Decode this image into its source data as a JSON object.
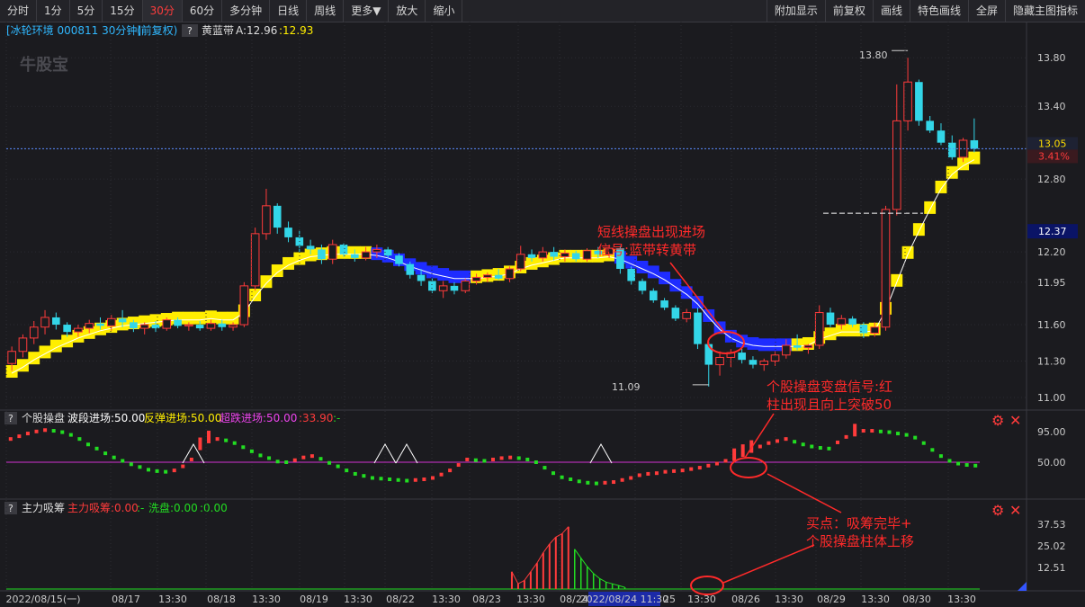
{
  "toolbar": {
    "left": [
      "分时",
      "1分",
      "5分",
      "15分",
      "30分",
      "60分",
      "多分钟",
      "日线",
      "周线",
      "更多▼",
      "放大",
      "缩小"
    ],
    "active": "30分",
    "right": [
      "附加显示",
      "前复权",
      "画线",
      "特色画线",
      "全屏",
      "隐藏主图指标"
    ]
  },
  "header": {
    "stock": "[冰轮环境 000811 30分钟]",
    "fq": "(前复权)",
    "q": "?",
    "indicator": "黄蓝带",
    "a_label": "A:12.96",
    "b_label": ":12.93",
    "watermark": "牛股宝"
  },
  "panel2": {
    "q": "?",
    "name": "个股操盘",
    "l1": "波段进场:50.00",
    "l2": "反弹进场:50.00",
    "l3": "超跌进场:50.00",
    "l4": ":33.90",
    "l5": ":-"
  },
  "panel3": {
    "q": "?",
    "name": "主力吸筹",
    "l1": "主力吸筹:0.00",
    "l2": ":-",
    "l3": "洗盘:0.00",
    "l4": ":0.00"
  },
  "annotations": {
    "a1": [
      "短线操盘出现进场",
      "信号:蓝带转黄带"
    ],
    "a2": [
      "个股操盘变盘信号:红",
      "柱出现且向上突破50"
    ],
    "a3": [
      "买点：吸筹完毕+",
      "个股操盘柱体上移"
    ],
    "high_label": "13.80",
    "low_label": "11.09"
  },
  "colors": {
    "up": "#ff3b3b",
    "down": "#33d6e8",
    "yellow": "#ffee00",
    "blue": "#1e2cff",
    "annot": "#ff2a2a",
    "green": "#22dd22",
    "magenta": "#d030d0"
  },
  "chart_data": [
    {
      "type": "candlestick",
      "title": "冰轮环境 000811 30分钟",
      "ylim": [
        11.0,
        13.95
      ],
      "y_ticks": [
        "13.80",
        "13.40",
        "12.80",
        "12.20",
        "11.95",
        "11.60",
        "11.30",
        "11.00"
      ],
      "current_price": "13.05",
      "change_pct": "3.41%",
      "cursor_price": "12.37",
      "x_labels": [
        "2022/08/15(一)",
        "08/17",
        "13:30",
        "08/18",
        "13:30",
        "08/19",
        "13:30",
        "08/22",
        "13:30",
        "08/23",
        "13:30",
        "08/24",
        "2022/08/24 11:30",
        "25",
        "13:30",
        "08/26",
        "13:30",
        "08/29",
        "13:30",
        "08/30",
        "13:30"
      ],
      "ohlc": [
        [
          11.28,
          11.42,
          11.22,
          11.38
        ],
        [
          11.38,
          11.52,
          11.33,
          11.49
        ],
        [
          11.49,
          11.63,
          11.44,
          11.58
        ],
        [
          11.58,
          11.72,
          11.52,
          11.66
        ],
        [
          11.66,
          11.7,
          11.56,
          11.6
        ],
        [
          11.6,
          11.62,
          11.5,
          11.54
        ],
        [
          11.54,
          11.6,
          11.5,
          11.57
        ],
        [
          11.57,
          11.64,
          11.53,
          11.61
        ],
        [
          11.61,
          11.66,
          11.56,
          11.59
        ],
        [
          11.59,
          11.68,
          11.55,
          11.65
        ],
        [
          11.65,
          11.72,
          11.58,
          11.62
        ],
        [
          11.62,
          11.64,
          11.54,
          11.57
        ],
        [
          11.57,
          11.62,
          11.52,
          11.6
        ],
        [
          11.6,
          11.63,
          11.54,
          11.57
        ],
        [
          11.57,
          11.66,
          11.55,
          11.64
        ],
        [
          11.64,
          11.66,
          11.57,
          11.59
        ],
        [
          11.59,
          11.62,
          11.55,
          11.6
        ],
        [
          11.6,
          11.63,
          11.55,
          11.57
        ],
        [
          11.57,
          11.64,
          11.55,
          11.61
        ],
        [
          11.61,
          11.64,
          11.55,
          11.58
        ],
        [
          11.58,
          11.62,
          11.55,
          11.6
        ],
        [
          11.6,
          11.95,
          11.58,
          11.92
        ],
        [
          11.92,
          12.4,
          11.88,
          12.35
        ],
        [
          12.35,
          12.72,
          12.3,
          12.58
        ],
        [
          12.58,
          12.6,
          12.35,
          12.4
        ],
        [
          12.4,
          12.45,
          12.28,
          12.32
        ],
        [
          12.32,
          12.38,
          12.2,
          12.25
        ],
        [
          12.25,
          12.3,
          12.18,
          12.22
        ],
        [
          12.22,
          12.26,
          12.1,
          12.14
        ],
        [
          12.14,
          12.3,
          12.1,
          12.26
        ],
        [
          12.26,
          12.27,
          12.16,
          12.18
        ],
        [
          12.18,
          12.22,
          12.12,
          12.15
        ],
        [
          12.15,
          12.24,
          12.13,
          12.2
        ],
        [
          12.2,
          12.26,
          12.15,
          12.22
        ],
        [
          12.22,
          12.24,
          12.15,
          12.17
        ],
        [
          12.17,
          12.19,
          12.08,
          12.1
        ],
        [
          12.1,
          12.12,
          11.98,
          12.01
        ],
        [
          12.01,
          12.06,
          11.92,
          11.96
        ],
        [
          11.96,
          11.98,
          11.86,
          11.88
        ],
        [
          11.88,
          11.96,
          11.82,
          11.92
        ],
        [
          11.92,
          11.95,
          11.85,
          11.88
        ],
        [
          11.88,
          11.98,
          11.86,
          11.96
        ],
        [
          11.96,
          12.02,
          11.93,
          11.99
        ],
        [
          11.99,
          12.03,
          11.95,
          12.01
        ],
        [
          12.01,
          12.06,
          11.97,
          11.98
        ],
        [
          11.98,
          12.08,
          11.95,
          12.06
        ],
        [
          12.06,
          12.25,
          12.04,
          12.18
        ],
        [
          12.18,
          12.22,
          12.12,
          12.15
        ],
        [
          12.15,
          12.24,
          12.12,
          12.2
        ],
        [
          12.2,
          12.24,
          12.13,
          12.16
        ],
        [
          12.16,
          12.22,
          12.12,
          12.19
        ],
        [
          12.19,
          12.21,
          12.12,
          12.14
        ],
        [
          12.14,
          12.23,
          12.12,
          12.21
        ],
        [
          12.21,
          12.24,
          12.15,
          12.18
        ],
        [
          12.18,
          12.26,
          12.15,
          12.23
        ],
        [
          12.23,
          12.25,
          12.02,
          12.06
        ],
        [
          12.06,
          12.08,
          11.93,
          11.96
        ],
        [
          11.96,
          11.98,
          11.85,
          11.88
        ],
        [
          11.88,
          11.9,
          11.78,
          11.8
        ],
        [
          11.8,
          11.82,
          11.72,
          11.74
        ],
        [
          11.74,
          11.76,
          11.63,
          11.65
        ],
        [
          11.65,
          11.73,
          11.62,
          11.7
        ],
        [
          11.7,
          11.74,
          11.4,
          11.44
        ],
        [
          11.44,
          11.46,
          11.09,
          11.27
        ],
        [
          11.27,
          11.38,
          11.18,
          11.33
        ],
        [
          11.33,
          11.4,
          11.25,
          11.37
        ],
        [
          11.37,
          11.4,
          11.28,
          11.31
        ],
        [
          11.31,
          11.34,
          11.24,
          11.27
        ],
        [
          11.27,
          11.32,
          11.22,
          11.3
        ],
        [
          11.3,
          11.38,
          11.26,
          11.35
        ],
        [
          11.35,
          11.48,
          11.32,
          11.43
        ],
        [
          11.43,
          11.52,
          11.39,
          11.41
        ],
        [
          11.41,
          11.44,
          11.36,
          11.43
        ],
        [
          11.43,
          11.76,
          11.4,
          11.7
        ],
        [
          11.7,
          11.74,
          11.58,
          11.6
        ],
        [
          11.6,
          11.68,
          11.56,
          11.65
        ],
        [
          11.65,
          11.67,
          11.58,
          11.6
        ],
        [
          11.6,
          11.62,
          11.49,
          11.53
        ],
        [
          11.53,
          11.62,
          11.5,
          11.58
        ],
        [
          11.58,
          12.58,
          11.55,
          12.55
        ],
        [
          12.55,
          13.58,
          12.5,
          13.28
        ],
        [
          13.28,
          13.8,
          13.2,
          13.6
        ],
        [
          13.6,
          13.62,
          13.24,
          13.28
        ],
        [
          13.28,
          13.32,
          13.18,
          13.2
        ],
        [
          13.2,
          13.26,
          13.08,
          13.1
        ],
        [
          13.1,
          13.16,
          12.96,
          12.98
        ],
        [
          12.98,
          13.14,
          12.94,
          13.12
        ],
        [
          13.12,
          13.3,
          13.02,
          13.05
        ]
      ],
      "ribbon_color": [
        "y",
        "y",
        "y",
        "y",
        "y",
        "y",
        "y",
        "y",
        "y",
        "y",
        "y",
        "y",
        "y",
        "y",
        "y",
        "y",
        "y",
        "y",
        "y",
        "y",
        "y",
        "y",
        "y",
        "y",
        "y",
        "y",
        "y",
        "y",
        "y",
        "y",
        "y",
        "y",
        "y",
        "b",
        "b",
        "b",
        "b",
        "b",
        "b",
        "b",
        "b",
        "b",
        "y",
        "y",
        "y",
        "y",
        "y",
        "y",
        "y",
        "y",
        "y",
        "y",
        "y",
        "y",
        "y",
        "b",
        "b",
        "b",
        "b",
        "b",
        "b",
        "b",
        "b",
        "b",
        "b",
        "b",
        "b",
        "b",
        "b",
        "b",
        "b",
        "y",
        "y",
        "y",
        "y",
        "y",
        "y",
        "y",
        "y",
        "y",
        "y",
        "y",
        "y",
        "y",
        "y",
        "y",
        "y",
        "y"
      ],
      "ribbon_value": [
        11.2,
        11.25,
        11.31,
        11.36,
        11.41,
        11.45,
        11.49,
        11.52,
        11.55,
        11.57,
        11.59,
        11.6,
        11.61,
        11.62,
        11.63,
        11.64,
        11.64,
        11.64,
        11.65,
        11.64,
        11.64,
        11.7,
        11.83,
        11.94,
        12.03,
        12.09,
        12.13,
        12.16,
        12.17,
        12.18,
        12.18,
        12.18,
        12.18,
        12.17,
        12.15,
        12.12,
        12.08,
        12.05,
        12.02,
        12.0,
        11.98,
        11.98,
        11.98,
        11.99,
        12.0,
        12.02,
        12.06,
        12.09,
        12.11,
        12.13,
        12.15,
        12.15,
        12.15,
        12.15,
        12.16,
        12.14,
        12.1,
        12.06,
        12.02,
        11.97,
        11.91,
        11.85,
        11.77,
        11.66,
        11.56,
        11.49,
        11.45,
        11.43,
        11.42,
        11.42,
        11.42,
        11.42,
        11.43,
        11.48,
        11.51,
        11.54,
        11.54,
        11.54,
        11.55,
        11.72,
        11.95,
        12.18,
        12.37,
        12.55,
        12.72,
        12.84,
        12.91,
        12.96
      ]
    },
    {
      "type": "bar",
      "title": "个股操盘",
      "ylim": [
        0,
        100
      ],
      "y_ticks": [
        "95.00",
        "50.00"
      ],
      "reference_line": 50,
      "values": [
        84,
        88,
        92,
        95,
        97,
        96,
        94,
        90,
        84,
        76,
        70,
        63,
        57,
        52,
        47,
        43,
        39,
        37,
        36,
        38,
        44,
        54,
        73,
        83,
        84,
        82,
        78,
        72,
        66,
        60,
        56,
        51,
        50,
        53,
        57,
        59,
        55,
        49,
        44,
        38,
        33,
        30,
        27,
        26,
        25,
        24,
        23,
        24,
        25,
        27,
        32,
        38,
        46,
        54,
        53,
        52,
        54,
        56,
        57,
        56,
        54,
        50,
        42,
        34,
        28,
        25,
        22,
        20,
        19,
        20,
        21,
        24,
        27,
        31,
        33,
        34,
        36,
        37,
        38,
        40,
        42,
        45,
        48,
        52,
        57,
        63,
        69,
        73,
        78,
        81,
        84,
        80,
        76,
        73,
        71,
        70,
        79,
        87,
        93,
        96,
        96,
        95,
        94,
        92,
        90,
        86,
        78,
        68,
        59,
        52,
        48,
        46,
        45
      ]
    },
    {
      "type": "bar",
      "title": "主力吸筹",
      "ylim": [
        0,
        40
      ],
      "y_ticks": [
        "37.53",
        "25.02",
        "12.51"
      ],
      "red_values": [
        0,
        0,
        0,
        0,
        0,
        0,
        0,
        0,
        0,
        0,
        0,
        0,
        0,
        0,
        0,
        0,
        0,
        0,
        0,
        0,
        0,
        0,
        0,
        0,
        0,
        0,
        0,
        0,
        0,
        0,
        0,
        0,
        0,
        0,
        0,
        0,
        0,
        0,
        0,
        0,
        0,
        0,
        0,
        0,
        0,
        0,
        0,
        0,
        0,
        0,
        0,
        0,
        0,
        0,
        0,
        0,
        0,
        0,
        0,
        0,
        0,
        0,
        0,
        0,
        0,
        0,
        0,
        0,
        0,
        0,
        0,
        0,
        0,
        0,
        0,
        0,
        0,
        0,
        0,
        0,
        10,
        3,
        5,
        10,
        15,
        21,
        26,
        30,
        32,
        36,
        0,
        0,
        0,
        0,
        0,
        0,
        0,
        0,
        0,
        0,
        0,
        0,
        0,
        0,
        0,
        0,
        0,
        0,
        0,
        0,
        0,
        0,
        0,
        0,
        0,
        0,
        0,
        0,
        0,
        0,
        0,
        0,
        0,
        0,
        0,
        0,
        0,
        0,
        0,
        0,
        0,
        0,
        0,
        0,
        0,
        0,
        0,
        0,
        0,
        0,
        0,
        0,
        0,
        0,
        0,
        0,
        0,
        0,
        0,
        0,
        0,
        0,
        0,
        0,
        0
      ],
      "green_values": [
        0,
        0,
        0,
        0,
        0,
        0,
        0,
        0,
        0,
        0,
        0,
        0,
        0,
        0,
        0,
        0,
        0,
        0,
        0,
        0,
        0,
        0,
        0,
        0,
        0,
        0,
        0,
        0,
        0,
        0,
        0,
        0,
        0,
        0,
        0,
        0,
        0,
        0,
        0,
        0,
        0,
        0,
        0,
        0,
        0,
        0,
        0,
        0,
        0,
        0,
        0,
        0,
        0,
        0,
        0,
        0,
        0,
        0,
        0,
        0,
        0,
        0,
        0,
        0,
        0,
        0,
        0,
        0,
        0,
        0,
        0,
        0,
        0,
        0,
        0,
        0,
        0,
        0,
        0,
        0,
        0,
        0,
        0,
        0,
        0,
        0,
        0,
        0,
        0,
        0,
        23,
        18,
        13,
        9,
        6,
        4,
        3,
        2,
        1,
        0,
        0,
        0,
        0,
        0,
        0,
        0,
        0,
        0,
        0,
        0,
        0,
        0,
        0,
        0,
        0,
        0,
        0,
        0,
        0,
        0,
        0,
        0,
        0,
        0,
        0,
        0,
        0,
        0,
        0,
        0,
        0,
        0,
        0,
        0,
        0,
        0,
        0,
        0,
        0,
        0,
        0,
        0,
        0,
        0,
        0,
        0,
        0,
        0,
        0,
        0,
        0,
        0,
        0,
        0,
        0
      ]
    }
  ]
}
